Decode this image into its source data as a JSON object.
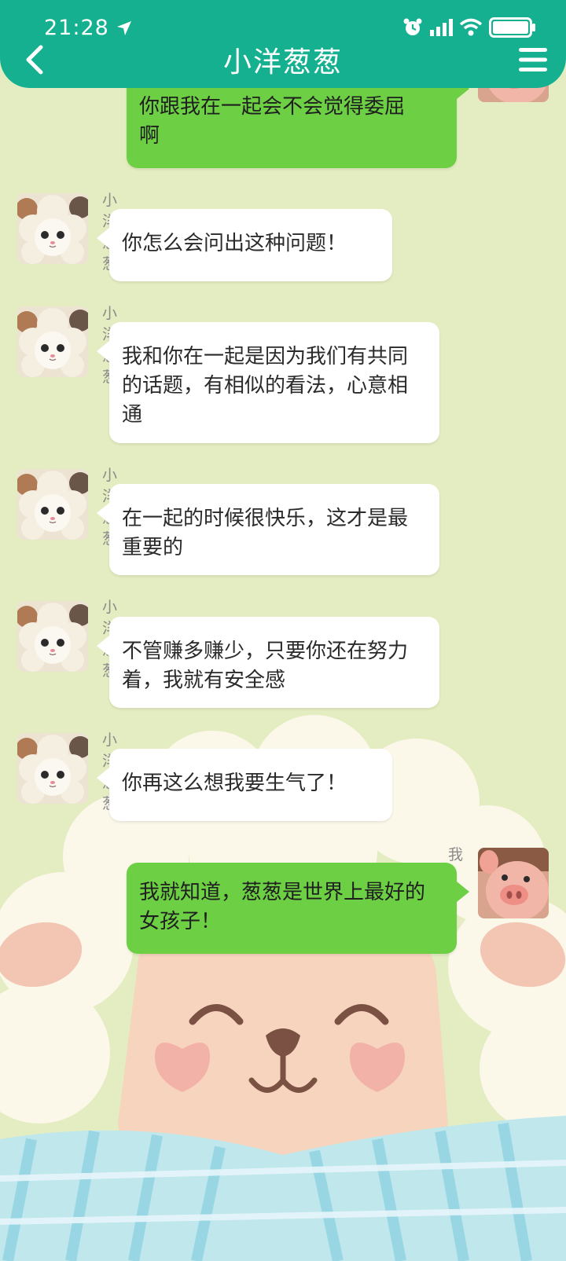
{
  "status_bar": {
    "time": "21:28",
    "location_icon": "location-arrow-icon",
    "alarm_icon": "alarm-clock-icon",
    "signal_icon": "signal-bars-icon",
    "wifi_icon": "wifi-icon",
    "battery_icon": "battery-icon"
  },
  "header": {
    "title": "小洋葱葱",
    "back_icon": "chevron-left-icon",
    "menu_icon": "hamburger-menu-icon",
    "color": "#14b08f"
  },
  "colors": {
    "background": "#e4edc1",
    "incoming_bubble": "#ffffff",
    "outgoing_bubble": "#6ccf44"
  },
  "messages": [
    {
      "direction": "outgoing",
      "sender": "",
      "text": "我就赚那么多，很男很卡的，你跟我在一起会不会觉得委屈啊"
    },
    {
      "direction": "incoming",
      "sender": "小洋葱葱",
      "text": "你怎么会问出这种问题！"
    },
    {
      "direction": "incoming",
      "sender": "小洋葱葱",
      "text": "我和你在一起是因为我们有共同的话题，有相似的看法，心意相通"
    },
    {
      "direction": "incoming",
      "sender": "小洋葱葱",
      "text": "在一起的时候很快乐，这才是最重要的"
    },
    {
      "direction": "incoming",
      "sender": "小洋葱葱",
      "text": "不管赚多赚少，只要你还在努力着，我就有安全感"
    },
    {
      "direction": "incoming",
      "sender": "小洋葱葱",
      "text": "你再这么想我要生气了！"
    },
    {
      "direction": "outgoing",
      "sender": "我",
      "text": "我就知道，葱葱是世界上最好的女孩子！"
    }
  ],
  "first_message_visible_lines": [
    "你跟我在一起会不会觉得委屈",
    "啊"
  ]
}
